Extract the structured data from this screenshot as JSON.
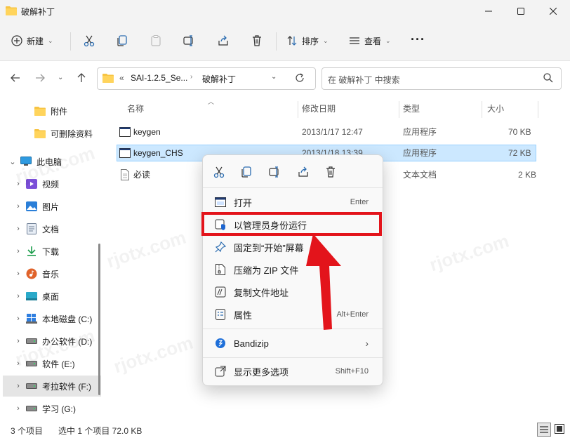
{
  "window": {
    "title": "破解补丁",
    "controls": [
      "minimize-icon",
      "maximize-icon",
      "close-icon"
    ]
  },
  "toolbar": {
    "new_label": "新建",
    "sort_label": "排序",
    "view_label": "查看",
    "more_label": "···",
    "icons": [
      "cut-icon",
      "copy-icon",
      "paste-icon",
      "rename-icon",
      "share-icon",
      "delete-icon"
    ]
  },
  "address": {
    "path_prefix": "«",
    "segment1": "SAI-1.2.5_Se...",
    "segment2": "破解补丁",
    "search_placeholder": "在 破解补丁 中搜索"
  },
  "nav": {
    "items": [
      {
        "label": "附件",
        "icon": "folder-icon"
      },
      {
        "label": "可删除资料",
        "icon": "folder-icon"
      },
      {
        "label": "此电脑",
        "icon": "pc-icon"
      },
      {
        "label": "视频",
        "icon": "video-icon"
      },
      {
        "label": "图片",
        "icon": "picture-icon"
      },
      {
        "label": "文档",
        "icon": "document-icon"
      },
      {
        "label": "下载",
        "icon": "download-icon"
      },
      {
        "label": "音乐",
        "icon": "music-icon"
      },
      {
        "label": "桌面",
        "icon": "desktop-icon"
      },
      {
        "label": "本地磁盘 (C:)",
        "icon": "windows-drive-icon"
      },
      {
        "label": "办公软件 (D:)",
        "icon": "drive-icon"
      },
      {
        "label": "软件 (E:)",
        "icon": "drive-icon"
      },
      {
        "label": "考拉软件 (F:)",
        "icon": "drive-icon"
      },
      {
        "label": "学习 (G:)",
        "icon": "drive-icon"
      }
    ]
  },
  "columns": {
    "name": "名称",
    "date": "修改日期",
    "type": "类型",
    "size": "大小"
  },
  "files": [
    {
      "name": "keygen",
      "date": "2013/1/17 12:47",
      "type": "应用程序",
      "size": "70 KB",
      "icon": "app-icon"
    },
    {
      "name": "keygen_CHS",
      "date": "2013/1/18 13:39",
      "type": "应用程序",
      "size": "72 KB",
      "icon": "app-icon"
    },
    {
      "name": "必读",
      "date": "",
      "type": "文本文档",
      "size": "2 KB",
      "icon": "text-file-icon"
    }
  ],
  "status": {
    "count": "3 个项目",
    "selection": "选中 1 个项目  72.0 KB"
  },
  "context_menu": {
    "items": [
      {
        "label": "打开",
        "shortcut": "Enter"
      },
      {
        "label": "以管理员身份运行",
        "shortcut": ""
      },
      {
        "label": "固定到“开始”屏幕",
        "shortcut": ""
      },
      {
        "label": "压缩为 ZIP 文件",
        "shortcut": ""
      },
      {
        "label": "复制文件地址",
        "shortcut": ""
      },
      {
        "label": "属性",
        "shortcut": "Alt+Enter"
      },
      {
        "label": "Bandizip",
        "shortcut": ""
      },
      {
        "label": "显示更多选项",
        "shortcut": "Shift+F10"
      }
    ],
    "submenu_arrow": "›"
  },
  "colors": {
    "highlight_box": "#e3141b",
    "selection": "#cce8ff",
    "folder": "#f7c443"
  }
}
